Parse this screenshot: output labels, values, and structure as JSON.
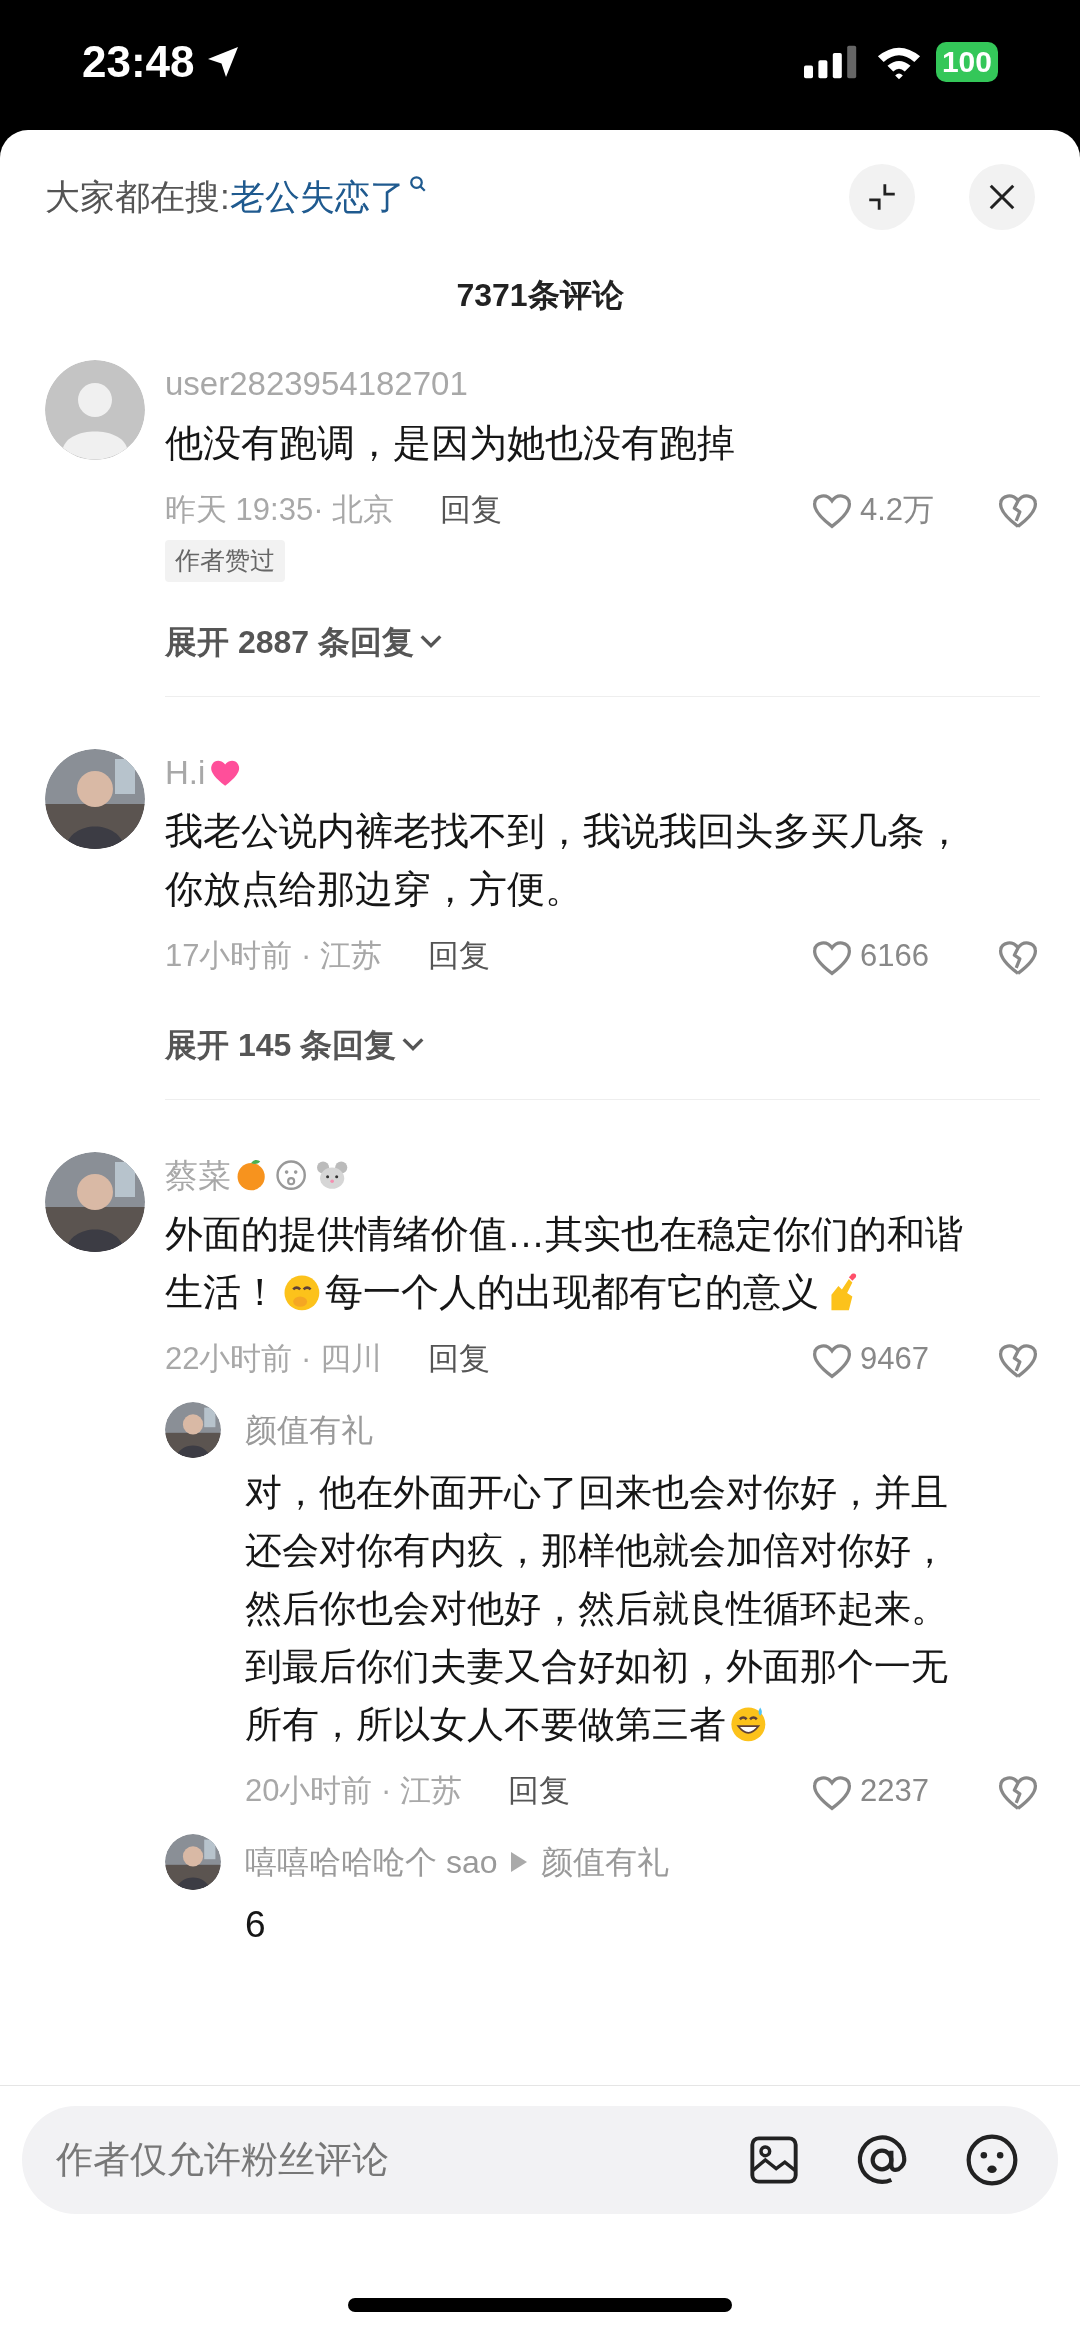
{
  "status_bar": {
    "time": "23:48",
    "battery": "100"
  },
  "header": {
    "label": "大家都在搜:",
    "query": "老公失恋了"
  },
  "comment_count": "7371条评论",
  "comments": [
    {
      "avatar": {
        "kind": "default"
      },
      "name": [
        {
          "kind": "text",
          "text": "user2823954182701"
        }
      ],
      "lines": [
        [
          {
            "kind": "text",
            "text": "他没有跑调，是因为她也没有跑掉"
          }
        ]
      ],
      "meta": "昨天 19:35· 北京",
      "reply": "回复",
      "likes": "4.2万",
      "badge": "作者赞过",
      "expand": "展开 2887 条回复"
    },
    {
      "avatar": {
        "kind": "picture"
      },
      "name": [
        {
          "kind": "text",
          "text": "H.i"
        },
        {
          "kind": "heart"
        }
      ],
      "lines": [
        [
          {
            "kind": "text",
            "text": "我老公说内裤老找不到，我说我回头多买几条，"
          }
        ],
        [
          {
            "kind": "text",
            "text": "你放点给那边穿，方便。"
          }
        ]
      ],
      "meta": "17小时前 · 江苏",
      "reply": "回复",
      "likes": "6166",
      "expand": "展开 145 条回复"
    },
    {
      "avatar": {
        "kind": "picture"
      },
      "name": [
        {
          "kind": "text",
          "text": "蔡菜"
        },
        {
          "kind": "fruit"
        },
        {
          "kind": "face"
        },
        {
          "kind": "mouse"
        }
      ],
      "lines": [
        [
          {
            "kind": "text",
            "text": "外面的提供情绪价值…其实也在稳定你们的和谐"
          }
        ],
        [
          {
            "kind": "text",
            "text": "生活！"
          },
          {
            "kind": "smirk"
          },
          {
            "kind": "text",
            "text": "每一个人的出现都有它的意义"
          },
          {
            "kind": "hand"
          }
        ]
      ],
      "meta": "22小时前 · 四川",
      "reply": "回复",
      "likes": "9467",
      "replies": [
        {
          "avatar": {
            "kind": "picture"
          },
          "name": [
            {
              "kind": "text",
              "text": "颜值有礼"
            }
          ],
          "lines": [
            [
              {
                "kind": "text",
                "text": "对，他在外面开心了回来也会对你好，并且"
              }
            ],
            [
              {
                "kind": "text",
                "text": "还会对你有内疚，那样他就会加倍对你好，"
              }
            ],
            [
              {
                "kind": "text",
                "text": "然后你也会对他好，然后就良性循环起来。"
              }
            ],
            [
              {
                "kind": "text",
                "text": "到最后你们夫妻又合好如初，外面那个一无"
              }
            ],
            [
              {
                "kind": "text",
                "text": "所有，所以女人不要做第三者"
              },
              {
                "kind": "grin"
              }
            ]
          ],
          "meta": "20小时前 · 江苏",
          "reply": "回复",
          "likes": "2237"
        },
        {
          "avatar": {
            "kind": "picture"
          },
          "name": [
            {
              "kind": "text",
              "text": "嘻嘻哈哈呛个 sao"
            }
          ],
          "target": "颜值有礼",
          "lines": [
            [
              {
                "kind": "text",
                "text": "6"
              }
            ]
          ]
        }
      ]
    }
  ],
  "input": {
    "placeholder": "作者仅允许粉丝评论"
  }
}
